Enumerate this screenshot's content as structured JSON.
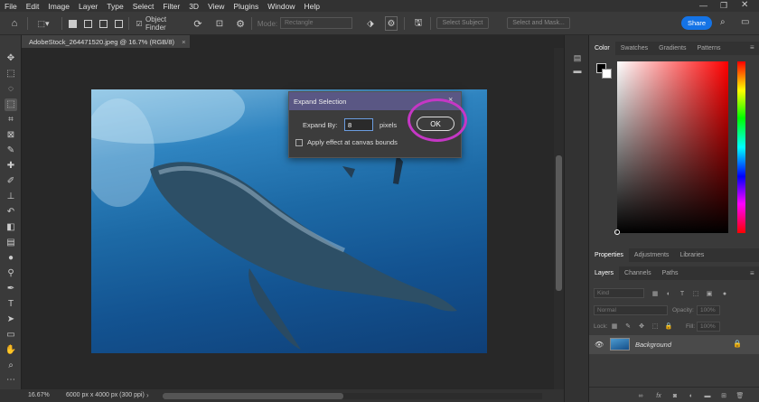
{
  "menu": [
    "File",
    "Edit",
    "Image",
    "Layer",
    "Type",
    "Select",
    "Filter",
    "3D",
    "View",
    "Plugins",
    "Window",
    "Help"
  ],
  "options_bar": {
    "object_finder_label": "Object Finder",
    "mode_label": "Mode:",
    "mode_value": "Rectangle",
    "select_subject": "Select Subject",
    "select_and_mask": "Select and Mask...",
    "share": "Share"
  },
  "document": {
    "tab_title": "AdobeStock_264471520.jpeg @ 16.7% (RGB/8)",
    "tab_close": "×"
  },
  "status": {
    "zoom": "16.67%",
    "doc_size": "6000 px x 4000 px (300 ppi)"
  },
  "dialog": {
    "title": "Expand Selection",
    "close": "×",
    "expand_by_label": "Expand By:",
    "expand_by_value": "8",
    "units": "pixels",
    "ok_label": "OK",
    "apply_canvas_label": "Apply effect at canvas bounds",
    "apply_canvas_checked": false
  },
  "panels": {
    "color_tabs": [
      "Color",
      "Swatches",
      "Gradients",
      "Patterns"
    ],
    "properties_tabs": [
      "Properties",
      "Adjustments",
      "Libraries"
    ],
    "layers_tabs": [
      "Layers",
      "Channels",
      "Paths"
    ],
    "kind_label": "Kind",
    "blend_mode": "Normal",
    "opacity_label": "Opacity:",
    "opacity_value": "100%",
    "lock_label": "Lock:",
    "fill_label": "Fill:",
    "fill_value": "100%",
    "layer_name": "Background"
  },
  "colors": {
    "accent": "#1473e6",
    "dialog_title": "#5a5784",
    "highlight_circle": "#c537c5"
  }
}
